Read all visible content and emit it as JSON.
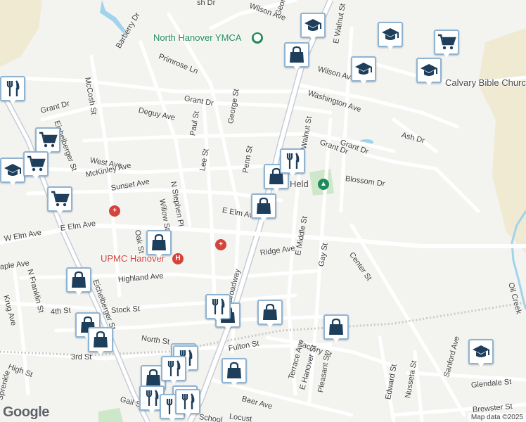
{
  "map": {
    "colors": {
      "background": "#f3f3f0",
      "road": "#ffffff",
      "road_edge": "#d6d6d6",
      "major_road": "#c6cdd6",
      "railway": "#c9c9c9",
      "park": "#cde8c8",
      "farmland": "#f0ead2",
      "water": "#9fd4ec",
      "marker_border": "#8fb4d2",
      "marker_icon": "#1e3f5c",
      "poi_green": "#1f8a5a",
      "poi_red": "#d2443c"
    }
  },
  "street_labels": [
    {
      "text": "sh Dr"
    },
    {
      "text": "Wilson Ave"
    },
    {
      "text": "George St"
    },
    {
      "text": "Barberry Dr"
    },
    {
      "text": "Primrose Ln"
    },
    {
      "text": "McCosh St"
    },
    {
      "text": "E Walnut St"
    },
    {
      "text": "Wilson Ave"
    },
    {
      "text": "Washington Ave"
    },
    {
      "text": "Grant Dr"
    },
    {
      "text": "Grant Dr"
    },
    {
      "text": "Deguy Ave"
    },
    {
      "text": "Paul St"
    },
    {
      "text": "George St"
    },
    {
      "text": "Ash Dr"
    },
    {
      "text": "Grant Dr"
    },
    {
      "text": "Eichelberger St"
    },
    {
      "text": "West Ave"
    },
    {
      "text": "Lee St"
    },
    {
      "text": "Penn St"
    },
    {
      "text": "Walnut St"
    },
    {
      "text": "McKinley Ave"
    },
    {
      "text": "Blossom Dr"
    },
    {
      "text": "Sunset Ave"
    },
    {
      "text": "N Stephen Pl"
    },
    {
      "text": "Willow St"
    },
    {
      "text": "E Elm Ave"
    },
    {
      "text": "E Elm Ave"
    },
    {
      "text": "W Elm Ave"
    },
    {
      "text": "Oak St"
    },
    {
      "text": "Cha"
    },
    {
      "text": "aple Ave"
    },
    {
      "text": "N Franklin St"
    },
    {
      "text": "Ridge Ave"
    },
    {
      "text": "E Middle St"
    },
    {
      "text": "Gay St"
    },
    {
      "text": "Center St"
    },
    {
      "text": "Highland Ave"
    },
    {
      "text": "Eichelberger St"
    },
    {
      "text": "Krug Ave"
    },
    {
      "text": "4th St"
    },
    {
      "text": "Stock St"
    },
    {
      "text": "Broadway"
    },
    {
      "text": "North St"
    },
    {
      "text": "Factory St"
    },
    {
      "text": "3rd St"
    },
    {
      "text": "Fulton St"
    },
    {
      "text": "High St"
    },
    {
      "text": "Terrace Ave"
    },
    {
      "text": "E Hanover St"
    },
    {
      "text": "Pleasant St"
    },
    {
      "text": "Sprenkle"
    },
    {
      "text": "Baer Ave"
    },
    {
      "text": "Edward St"
    },
    {
      "text": "Nusseta St"
    },
    {
      "text": "Sanford Ave"
    },
    {
      "text": "Glendale St"
    },
    {
      "text": "Brewster St"
    },
    {
      "text": "Locust"
    },
    {
      "text": "School"
    },
    {
      "text": "Gail St"
    },
    {
      "text": "Oil Creek"
    },
    {
      "text": "Grant Dr"
    }
  ],
  "pois": [
    {
      "name": "North Hanover YMCA"
    },
    {
      "name": "Calvary Bible Church"
    },
    {
      "name": "UPMC Hanover"
    },
    {
      "name": "Held"
    }
  ],
  "markers": [
    {
      "type": "school",
      "icon": "graduation-cap-icon"
    },
    {
      "type": "school",
      "icon": "graduation-cap-icon"
    },
    {
      "type": "school",
      "icon": "graduation-cap-icon"
    },
    {
      "type": "school",
      "icon": "graduation-cap-icon"
    },
    {
      "type": "school",
      "icon": "graduation-cap-icon"
    },
    {
      "type": "school",
      "icon": "graduation-cap-icon"
    },
    {
      "type": "grocery",
      "icon": "shopping-cart-icon"
    },
    {
      "type": "grocery",
      "icon": "shopping-cart-icon"
    },
    {
      "type": "grocery",
      "icon": "shopping-cart-icon"
    },
    {
      "type": "grocery",
      "icon": "shopping-cart-icon"
    },
    {
      "type": "shopping",
      "icon": "shopping-bag-icon"
    },
    {
      "type": "shopping",
      "icon": "shopping-bag-icon"
    },
    {
      "type": "shopping",
      "icon": "shopping-bag-icon"
    },
    {
      "type": "shopping",
      "icon": "shopping-bag-icon"
    },
    {
      "type": "shopping",
      "icon": "shopping-bag-icon"
    },
    {
      "type": "shopping",
      "icon": "shopping-bag-icon"
    },
    {
      "type": "shopping",
      "icon": "shopping-bag-icon"
    },
    {
      "type": "shopping",
      "icon": "shopping-bag-icon"
    },
    {
      "type": "shopping",
      "icon": "shopping-bag-icon"
    },
    {
      "type": "shopping",
      "icon": "shopping-bag-icon"
    },
    {
      "type": "shopping",
      "icon": "shopping-bag-icon"
    },
    {
      "type": "shopping",
      "icon": "shopping-bag-icon"
    },
    {
      "type": "shopping",
      "icon": "shopping-bag-icon"
    },
    {
      "type": "shopping",
      "icon": "shopping-bag-icon"
    },
    {
      "type": "restaurant",
      "icon": "fork-knife-icon"
    },
    {
      "type": "restaurant",
      "icon": "fork-knife-icon"
    },
    {
      "type": "restaurant",
      "icon": "fork-knife-icon"
    },
    {
      "type": "restaurant",
      "icon": "fork-knife-icon"
    },
    {
      "type": "restaurant",
      "icon": "fork-knife-icon"
    },
    {
      "type": "restaurant",
      "icon": "fork-knife-icon"
    },
    {
      "type": "restaurant",
      "icon": "fork-knife-icon"
    },
    {
      "type": "restaurant",
      "icon": "fork-knife-icon"
    }
  ],
  "attribution": "Map data ©2025",
  "logo": "Google"
}
